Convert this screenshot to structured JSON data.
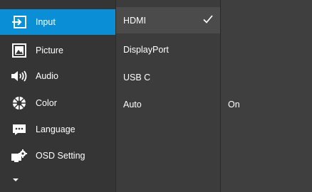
{
  "main_menu": {
    "items": [
      {
        "label": "Input",
        "icon": "input-icon"
      },
      {
        "label": "Picture",
        "icon": "picture-icon"
      },
      {
        "label": "Audio",
        "icon": "speaker-icon"
      },
      {
        "label": "Color",
        "icon": "color-wheel-icon"
      },
      {
        "label": "Language",
        "icon": "language-icon"
      },
      {
        "label": "OSD Setting",
        "icon": "osd-setting-icon"
      }
    ],
    "selected_index": 0,
    "more_indicator": "chevron-down-icon"
  },
  "sub_menu": {
    "items": [
      {
        "label": "HDMI",
        "checked": true
      },
      {
        "label": "DisplayPort",
        "checked": false
      },
      {
        "label": "USB C",
        "checked": false
      },
      {
        "label": "Auto",
        "checked": false
      }
    ],
    "selected_index": 0
  },
  "value_panel": {
    "value": "On"
  },
  "colors": {
    "accent": "#0a8fd6",
    "background": "#353535",
    "text": "#ffffff"
  }
}
